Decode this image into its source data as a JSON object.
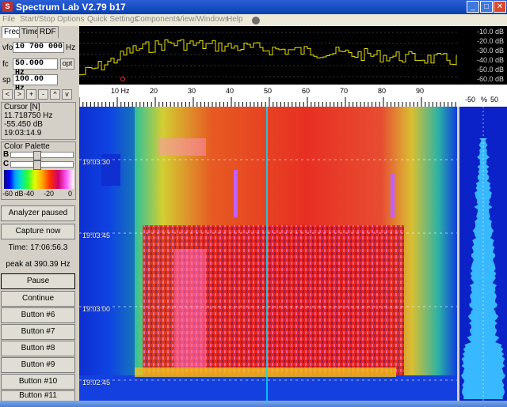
{
  "window": {
    "title": "Spectrum Lab V2.79 b17",
    "minimize": "_",
    "maximize": "□",
    "close": "✕"
  },
  "menu": [
    "File",
    "Start/Stop",
    "Options",
    "Quick Settings",
    "Components",
    "View/Windows",
    "Help"
  ],
  "tabs": [
    "Freq",
    "Time",
    "RDF"
  ],
  "controls": {
    "vfo_label": "vfo",
    "vfo_value": "10 700 000",
    "vfo_unit": "Hz",
    "fc_label": "fc",
    "fc_value": "50.000 Hz",
    "opt_label": "opt",
    "sp_label": "sp",
    "sp_value": "100.00 Hz",
    "nav": [
      "<",
      ">",
      "+",
      "-",
      "^",
      "v"
    ]
  },
  "cursor": {
    "title": "Cursor [N]",
    "freq": "11.718750 Hz",
    "level": "-55.450 dB",
    "time": "19:03:14.9"
  },
  "palette": {
    "title": "Color Palette",
    "b_label": "B",
    "c_label": "C",
    "scale": [
      "-60 dB",
      "-40",
      "-20",
      "0"
    ]
  },
  "buttons": {
    "analyzer_paused": "Analyzer paused",
    "capture_now": "Capture now",
    "time": "Time:  17:06:56.3",
    "peak": "peak at 390.39 Hz",
    "pause": "Pause",
    "continue": "Continue",
    "b6": "Button #6",
    "b7": "Button #7",
    "b8": "Button #8",
    "b9": "Button #9",
    "b10": "Button #10",
    "b11": "Button #11"
  },
  "spectrum": {
    "db_scale": [
      "-10.0 dB",
      "-20.0 dB",
      "-30.0 dB",
      "-40.0 dB",
      "-50.0 dB",
      "-60.0 dB"
    ],
    "freq_ticks": [
      "10 Hz",
      "20",
      "30",
      "40",
      "50",
      "60",
      "70",
      "80",
      "90"
    ],
    "pct_axis": [
      "-50",
      "%",
      "50"
    ]
  },
  "waterfall": {
    "time_labels": [
      "19:03:30",
      "19:03:45",
      "19:03:00",
      "19:02:45"
    ]
  },
  "colors": {
    "title_bar": "#0a3fb0",
    "trace": "#e8e000",
    "waterfall_bg": "#0f2fd0",
    "histogram": "#38b8ff"
  }
}
